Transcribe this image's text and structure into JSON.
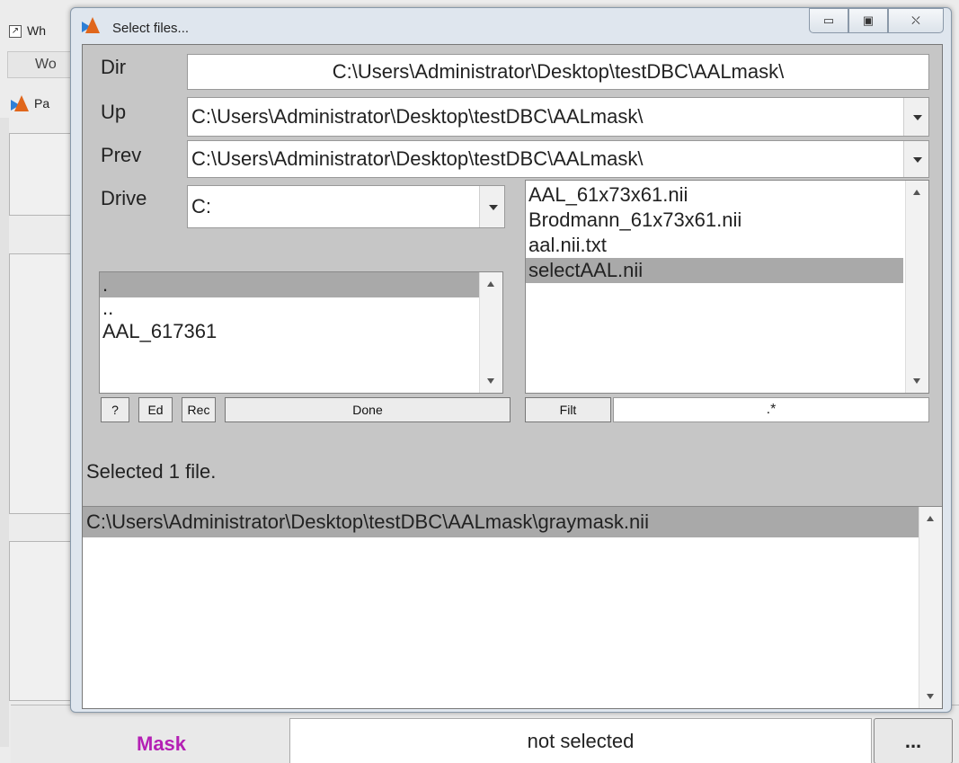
{
  "background_window": {
    "title_fragment": "Wh",
    "menu_fragment": "Wo",
    "panel_title_fragment": "Pa",
    "mask_label": "Mask",
    "mask_value": "not selected",
    "browse_label": "..."
  },
  "dialog": {
    "title": "Select files...",
    "window_buttons": {
      "minimize": "▭",
      "maximize": "▣",
      "close": "⛌"
    },
    "dir": {
      "label": "Dir",
      "value": "C:\\Users\\Administrator\\Desktop\\testDBC\\AALmask\\"
    },
    "up": {
      "label": "Up",
      "value": "C:\\Users\\Administrator\\Desktop\\testDBC\\AALmask\\"
    },
    "prev": {
      "label": "Prev",
      "value": "C:\\Users\\Administrator\\Desktop\\testDBC\\AALmask\\"
    },
    "drive": {
      "label": "Drive",
      "value": "C:"
    },
    "directories": [
      ".",
      "..",
      "AAL_617361"
    ],
    "files": [
      "AAL_61x73x61.nii",
      "Brodmann_61x73x61.nii",
      "aal.nii.txt",
      "selectAAL.nii"
    ],
    "buttons": {
      "help": "?",
      "edit": "Ed",
      "rec": "Rec",
      "done": "Done",
      "filter": "Filt"
    },
    "filter_value": ".*",
    "status": "Selected 1 file.",
    "selected_files": [
      "C:\\Users\\Administrator\\Desktop\\testDBC\\AALmask\\graymask.nii"
    ]
  }
}
